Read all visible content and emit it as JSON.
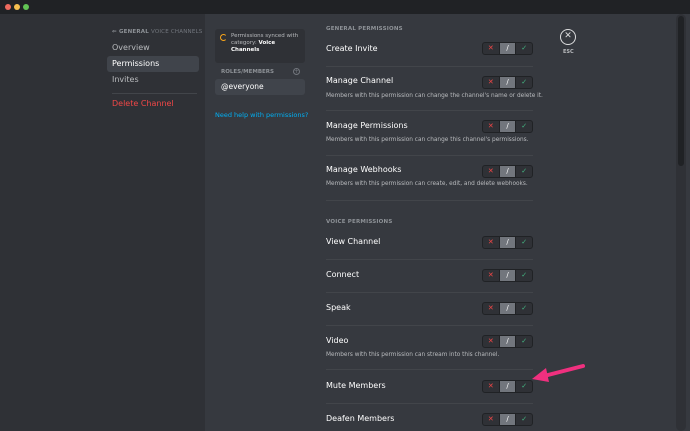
{
  "sidebar": {
    "header": "GENERAL",
    "header_sub": "VOICE CHANNELS",
    "items": [
      {
        "label": "Overview"
      },
      {
        "label": "Permissions"
      },
      {
        "label": "Invites"
      }
    ],
    "delete_label": "Delete Channel"
  },
  "middle": {
    "sync_text": "Permissions synced with category:",
    "sync_category": "Voice Channels",
    "roles_header": "ROLES/MEMBERS",
    "add_role_symbol": "+",
    "role": "@everyone",
    "help_link": "Need help with permissions?"
  },
  "general_permissions": {
    "header": "GENERAL PERMISSIONS",
    "items": [
      {
        "name": "Create Invite",
        "desc": ""
      },
      {
        "name": "Manage Channel",
        "desc": "Members with this permission can change the channel's name or delete it."
      },
      {
        "name": "Manage Permissions",
        "desc": "Members with this permission can change this channel's permissions."
      },
      {
        "name": "Manage Webhooks",
        "desc": "Members with this permission can create, edit, and delete webhooks."
      }
    ]
  },
  "voice_permissions": {
    "header": "VOICE PERMISSIONS",
    "items": [
      {
        "name": "View Channel",
        "desc": ""
      },
      {
        "name": "Connect",
        "desc": ""
      },
      {
        "name": "Speak",
        "desc": ""
      },
      {
        "name": "Video",
        "desc": "Members with this permission can stream into this channel."
      },
      {
        "name": "Mute Members",
        "desc": ""
      },
      {
        "name": "Deafen Members",
        "desc": ""
      }
    ]
  },
  "toggle": {
    "deny": "✕",
    "neutral": "/",
    "allow": "✓"
  },
  "close": {
    "symbol": "✕",
    "label": "ESC"
  },
  "colors": {
    "accent_deny": "#f04747",
    "accent_allow": "#43b581",
    "link": "#00b0f4",
    "arrow": "#f0307f"
  }
}
